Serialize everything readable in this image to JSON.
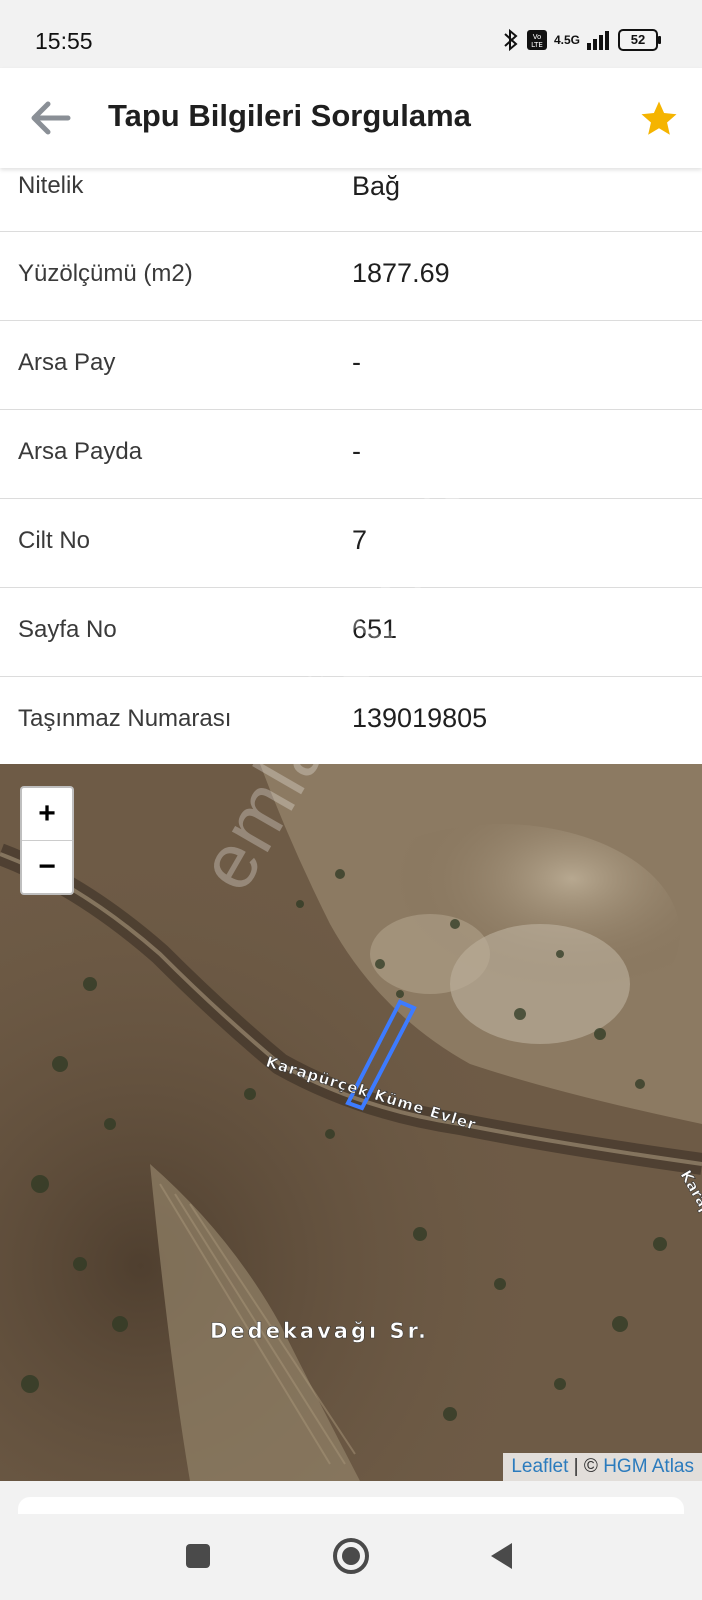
{
  "status": {
    "time": "15:55",
    "network": "4.5G",
    "battery": "52"
  },
  "header": {
    "title": "Tapu Bilgileri Sorgulama",
    "back_icon": "arrow-left-icon",
    "favorite_icon": "star-icon"
  },
  "rows": [
    {
      "label": "Nitelik",
      "value": "Bağ"
    },
    {
      "label": "Yüzölçümü (m2)",
      "value": "1877.69"
    },
    {
      "label": "Arsa Pay",
      "value": "-"
    },
    {
      "label": "Arsa Payda",
      "value": "-"
    },
    {
      "label": "Cilt No",
      "value": "7"
    },
    {
      "label": "Sayfa No",
      "value": "651"
    },
    {
      "label": "Taşınmaz Numarası",
      "value": "139019805"
    }
  ],
  "map": {
    "zoom_in": "+",
    "zoom_out": "−",
    "road_label": "Karapürçek Küme Evler",
    "road_label_edge": "Karap",
    "place_label": "Dedekavağı Sr.",
    "attribution_leaflet": "Leaflet",
    "attribution_sep": " | © ",
    "attribution_hgm": "HGM Atlas",
    "parcel_color": "#3d7bff"
  },
  "watermark": "emlakjet.com",
  "colors": {
    "star": "#f5b400",
    "link": "#2b7bbd"
  }
}
